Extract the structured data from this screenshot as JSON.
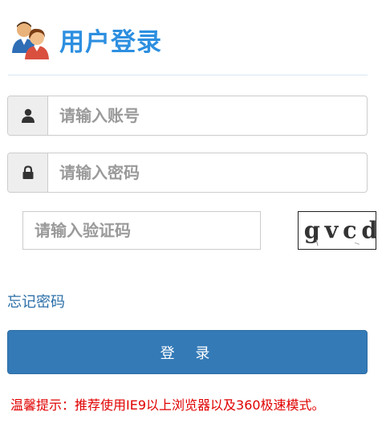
{
  "header": {
    "title": "用户登录",
    "icon": "users-icon"
  },
  "login_form": {
    "username": {
      "placeholder": "请输入账号",
      "icon": "user-icon"
    },
    "password": {
      "placeholder": "请输入密码",
      "icon": "lock-icon"
    },
    "captcha": {
      "placeholder": "请输入验证码",
      "image_text": "gvcd"
    },
    "forgot_password": "忘记密码",
    "submit_label": "登 录"
  },
  "tip": "温馨提示：推荐使用IE9以上浏览器以及360极速模式。",
  "colors": {
    "title": "#2d8fe0",
    "button": "#337ab7",
    "link": "#2b6fa8",
    "tip": "#e00000"
  }
}
